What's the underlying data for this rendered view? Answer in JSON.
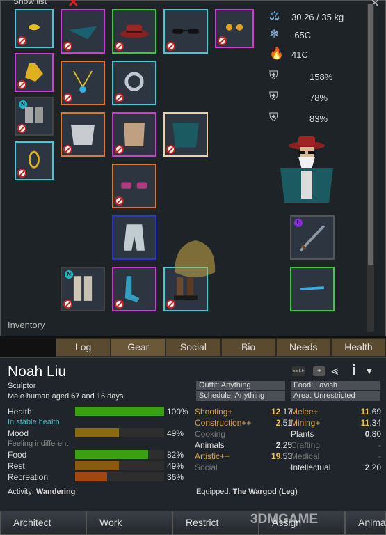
{
  "window": {
    "title": "Show list",
    "inventory_label": "Inventory"
  },
  "stats": {
    "mass": "30.26 / 35 kg",
    "cold": "-65C",
    "heat": "41C",
    "armor_sharp": "158%",
    "armor_blunt": "78%",
    "armor_heat": "83%"
  },
  "tabs": [
    "Log",
    "Gear",
    "Social",
    "Bio",
    "Needs",
    "Health"
  ],
  "pawn": {
    "name": "Noah Liu",
    "title": "Sculptor",
    "bio_prefix": "Male human aged ",
    "age": "67",
    "bio_suffix": " and 16 days"
  },
  "policies": {
    "outfit": "Outfit: Anything",
    "food": "Food: Lavish",
    "schedule": "Schedule: Anything",
    "area": "Area: Unrestricted"
  },
  "needs": [
    {
      "label": "Health",
      "pct": "100%",
      "value": 1.0,
      "color": "#3aa012",
      "sub": "In stable health",
      "sub_color": "#4fb6c8"
    },
    {
      "label": "Mood",
      "pct": "49%",
      "value": 0.49,
      "color": "#8a6a10",
      "sub": "Feeling indifferent",
      "sub_color": "#888"
    },
    {
      "label": "Food",
      "pct": "82%",
      "value": 0.82,
      "color": "#3aa012"
    },
    {
      "label": "Rest",
      "pct": "49%",
      "value": 0.49,
      "color": "#8a5a10"
    },
    {
      "label": "Recreation",
      "pct": "36%",
      "value": 0.36,
      "color": "#a04810"
    }
  ],
  "skills_left": [
    {
      "name": "Shooting+",
      "val": "12",
      "dec": ".17",
      "color": "#e0a040"
    },
    {
      "name": "Construction++",
      "val": "2",
      "dec": ".51",
      "color": "#e0a040"
    },
    {
      "name": "Cooking",
      "val": "",
      "dec": "-",
      "color": "#777"
    },
    {
      "name": "Animals",
      "val": "2",
      "dec": ".25",
      "color": "#ddd"
    },
    {
      "name": "Artistic++",
      "val": "19",
      "dec": ".53",
      "color": "#e0a040"
    },
    {
      "name": "Social",
      "val": "",
      "dec": "-",
      "color": "#777"
    }
  ],
  "skills_right": [
    {
      "name": "Melee+",
      "val": "11",
      "dec": ".69",
      "color": "#e0a040"
    },
    {
      "name": "Mining+",
      "val": "11",
      "dec": ".34",
      "color": "#e0a040"
    },
    {
      "name": "Plants",
      "val": "0",
      "dec": ".80",
      "color": "#ddd"
    },
    {
      "name": "Crafting",
      "val": "",
      "dec": "-",
      "color": "#777"
    },
    {
      "name": "Medical",
      "val": "",
      "dec": "-",
      "color": "#777"
    },
    {
      "name": "Intellectual",
      "val": "2",
      "dec": ".20",
      "color": "#ddd"
    }
  ],
  "activity": {
    "label": "Activity: ",
    "value": "Wandering"
  },
  "equipped": {
    "label": "Equipped: ",
    "value": "The Wargod (Leg)"
  },
  "bottom_buttons": [
    "Architect",
    "Work",
    "Restrict",
    "Assign",
    "Anima"
  ],
  "watermark": "3DMGAME",
  "self_badge": "SELF",
  "colors": {
    "cyan": "#3ecbd6",
    "magenta": "#d23ad8",
    "green": "#33d233",
    "orange": "#e07a1a",
    "blue": "#2a35d8",
    "peach": "#f0d09a"
  }
}
